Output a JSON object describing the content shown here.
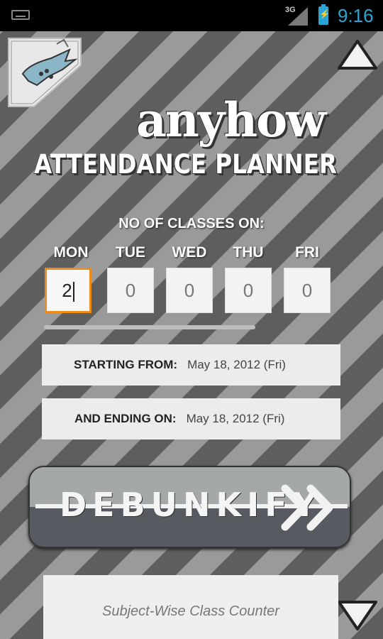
{
  "status_bar": {
    "network": "3G",
    "time": "9:16",
    "icons": [
      "keyboard-icon",
      "signal-icon",
      "battery-charging-icon"
    ]
  },
  "header": {
    "logo_icon": "bat-logo-icon",
    "title_script": "anyhow",
    "title_line": [
      "ATTENDANCE",
      "PLANNER"
    ],
    "nav_up_icon": "up-arrow-icon",
    "nav_down_icon": "down-arrow-icon"
  },
  "classes": {
    "label": "NO OF CLASSES ON:",
    "days": [
      {
        "label": "MON",
        "value": "2"
      },
      {
        "label": "TUE",
        "value": "0"
      },
      {
        "label": "WED",
        "value": "0"
      },
      {
        "label": "THU",
        "value": "0"
      },
      {
        "label": "FRI",
        "value": "0"
      }
    ]
  },
  "dates": {
    "start_label": "STARTING FROM:",
    "start_value": "May 18, 2012 (Fri)",
    "end_label": "AND ENDING ON:",
    "end_value": "May 18, 2012 (Fri)"
  },
  "action": {
    "label": "DEBUNKIFY",
    "icon": "double-arrow-icon"
  },
  "counter": {
    "label": "Subject-Wise Class Counter"
  },
  "colors": {
    "accent": "#f08c1c",
    "clock": "#2aa6d6"
  }
}
